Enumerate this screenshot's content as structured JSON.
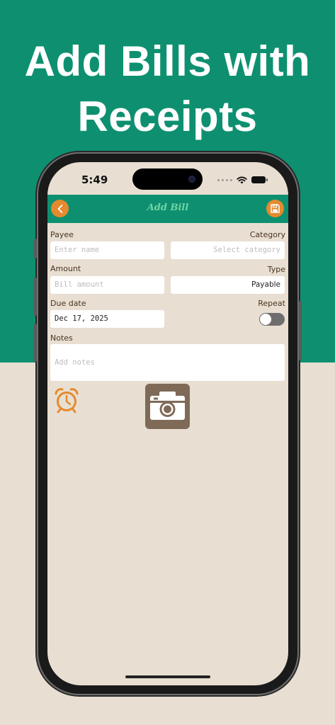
{
  "headline": {
    "line1": "Add Bills with",
    "line2": "Receipts"
  },
  "status_bar": {
    "time": "5:49"
  },
  "app_bar": {
    "title": "Add Bill",
    "back_icon": "chevron-left-icon",
    "save_icon": "floppy-disk-icon"
  },
  "form": {
    "payee": {
      "label": "Payee",
      "placeholder": "Enter name",
      "value": ""
    },
    "category": {
      "label": "Category",
      "placeholder": "Select category",
      "value": ""
    },
    "amount": {
      "label": "Amount",
      "placeholder": "Bill amount",
      "value": ""
    },
    "type": {
      "label": "Type",
      "value": "Payable"
    },
    "due_date": {
      "label": "Due date",
      "value": "Dec 17, 2025"
    },
    "repeat": {
      "label": "Repeat",
      "on": false
    },
    "notes": {
      "label": "Notes",
      "placeholder": "Add notes",
      "value": ""
    }
  },
  "icons": {
    "reminder": "alarm-clock-icon",
    "receipt": "camera-icon"
  },
  "colors": {
    "brand_green": "#0e9070",
    "accent_orange": "#e58a2e",
    "background": "#e8dfd2",
    "label_brown": "#4a3320",
    "camera_tile": "#7f6a58"
  }
}
